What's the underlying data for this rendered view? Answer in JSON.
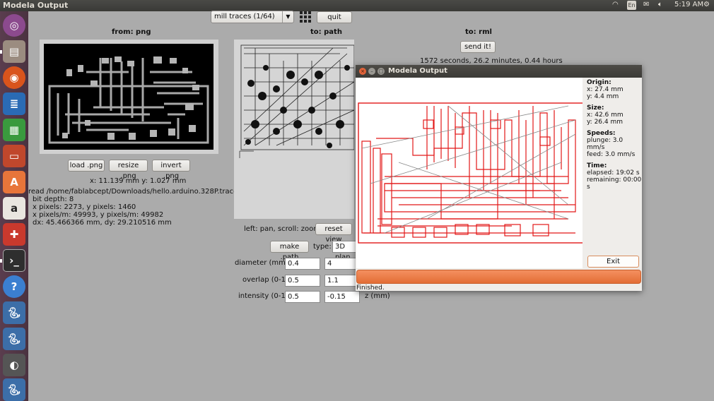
{
  "topbar": {
    "window_title": "Modela Output",
    "lang": "En",
    "time": "5:19 AM"
  },
  "launcher": {
    "icons": [
      "ubuntu-icon",
      "files-icon",
      "firefox-icon",
      "writer-icon",
      "calc-icon",
      "impress-icon",
      "software-center-icon",
      "amazon-icon",
      "settings-icon",
      "terminal-icon",
      "help-icon",
      "python-icon",
      "python-icon",
      "app-icon",
      "python-icon"
    ]
  },
  "app": {
    "mode_select": "mill traces (1/64)",
    "quit": "quit",
    "col_png": "from: png",
    "col_path": "to: path",
    "col_rml": "to: rml",
    "send": "send it!",
    "time_estimate": "1572 seconds, 26.2 minutes, 0.44 hours",
    "load_png": "load .png",
    "resize_png": "resize .png",
    "invert_png": "invert .png",
    "coords": "x: 11.139 mm  y: 1.027 mm",
    "info_lines": [
      "read /home/fablabcept/Downloads/hello.arduino.328P.traces.png",
      "bit depth: 8",
      "x pixels: 2273, y pixels: 1460",
      "x pixels/m: 49993, y pixels/m: 49982",
      "dx: 45.466366 mm, dy: 29.210516 mm"
    ],
    "pan_hint": "left: pan, scroll: zoom",
    "reset_view": "reset view",
    "make_path": "make .path",
    "type_label": "type:",
    "type_value": "3D plan",
    "diameter_label": "diameter (mm)",
    "diameter_value": "0.4",
    "diameter_value2": "4",
    "overlap_label": "overlap (0-1)",
    "overlap_value": "0.5",
    "overlap_value2": "1.1",
    "intensity_label": "intensity (0-1)",
    "intensity_value": "0.5",
    "intensity_value2": "-0.15",
    "z_label": "z (mm)"
  },
  "dialog": {
    "title": "Modela Output",
    "origin_label": "Origin:",
    "origin_x": "x: 27.4 mm",
    "origin_y": "y: 4.4 mm",
    "size_label": "Size:",
    "size_x": "x: 42.6 mm",
    "size_y": "y: 26.4 mm",
    "speeds_label": "Speeds:",
    "plunge": "plunge: 3.0 mm/s",
    "feed": "feed: 3.0 mm/s",
    "time_label": "Time:",
    "elapsed": "elapsed: 19:02 s",
    "remaining": "remaining: 00:00 s",
    "exit": "Exit",
    "status": "Finished.",
    "progress": 1.0
  }
}
